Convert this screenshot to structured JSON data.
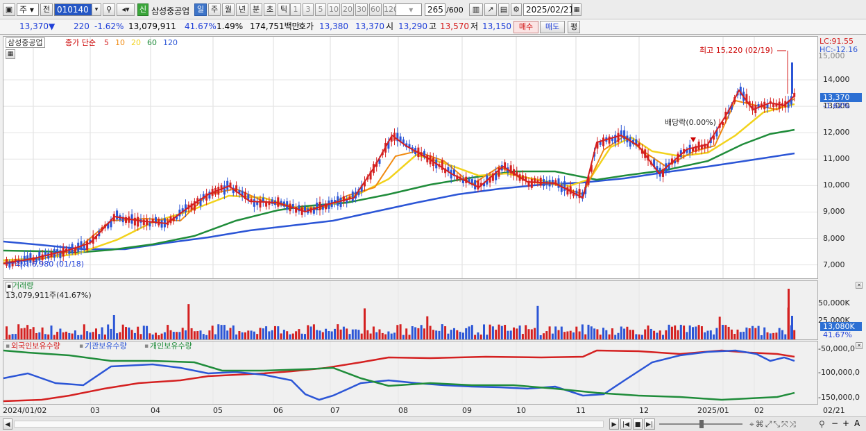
{
  "toolbar": {
    "market_select": "주",
    "prev_btn": "전",
    "code": "010140",
    "credit_badge": "신",
    "stock_name": "삼성중공업",
    "period_tabs": [
      "일",
      "주",
      "월",
      "년",
      "분",
      "초",
      "틱"
    ],
    "active_period": "일",
    "interval_btns": [
      "1",
      "3",
      "5",
      "10",
      "20",
      "30",
      "60",
      "120"
    ],
    "bars_value": "265",
    "bars_total": "/600",
    "date": "2025/02/21"
  },
  "quote": {
    "price": "13,370▼",
    "change": "220",
    "change_pct": "-1.62%",
    "volume": "13,079,911",
    "vol_ratio": "41.67%",
    "turnover_pct": "1.49%",
    "amount": "174,751백만",
    "bid_label": "호가",
    "ask_price": "13,380",
    "bid_price": "13,370",
    "open_label": "시",
    "open": "13,290",
    "high_label": "고",
    "high": "13,570",
    "low_label": "저",
    "low": "13,150",
    "buy": "매수",
    "sell": "매도",
    "avg": "평"
  },
  "price_panel": {
    "name": "삼성중공업",
    "legend_prefix": "종가 단순",
    "ma_periods": [
      "5",
      "10",
      "20",
      "60",
      "120"
    ],
    "ma_colors": [
      "#d42020",
      "#f08a10",
      "#f2d21b",
      "#1f8c3a",
      "#2b55d6"
    ],
    "lc": "LC:91.55",
    "hc": "HC:-12.16",
    "y_ticks": [
      "14,000",
      "13,000",
      "12,000",
      "11,000",
      "10,000",
      "9,000",
      "8,000",
      "7,000"
    ],
    "y_top_partial": "15,000",
    "price_tag": "13,370",
    "price_tag_pct": "-1.62%",
    "high_annotation": "최고 15,220 (02/19)",
    "low_annotation": "최저 6,980 (01/18)",
    "dividend_annotation": "배당락(0.00%)"
  },
  "volume_panel": {
    "title": "거래량",
    "value": "13,079,911주(41.67%)",
    "ticks": [
      "50,000K",
      "25,000K"
    ],
    "tag": "13,080K",
    "tag_pct": "41.67%"
  },
  "holdings_panel": {
    "legends": [
      "외국인보유수량",
      "기관보유수량",
      "개인보유수량"
    ],
    "legend_colors": [
      "#d42020",
      "#2b55d6",
      "#1f8c3a"
    ],
    "ticks": [
      "-50,000,0",
      "-100,000,0",
      "-150,000,0"
    ]
  },
  "x_axis": [
    "2024/01/02",
    "03",
    "04",
    "05",
    "06",
    "07",
    "08",
    "09",
    "10",
    "11",
    "12",
    "2025/01",
    "02",
    "02/21"
  ],
  "statusbar_controls": [
    "◀",
    "▶",
    "|◀",
    "■",
    "▶|",
    "−",
    "+",
    "A"
  ]
}
